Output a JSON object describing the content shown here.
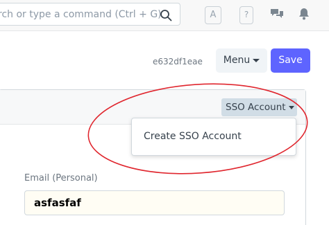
{
  "search": {
    "text": "rch or type a command (Ctrl + G)"
  },
  "navbar": {
    "avatar_letter": "A",
    "help_label": "?"
  },
  "document": {
    "id": "e632df1eae"
  },
  "toolbar": {
    "menu_label": "Menu",
    "save_label": "Save"
  },
  "form": {
    "sso_button_label": "SSO Account",
    "dropdown_items": [
      {
        "label": "Create SSO Account"
      }
    ],
    "email_label": "Email (Personal)",
    "email_value": "asfasfaf"
  },
  "colors": {
    "primary": "#5e64ff",
    "annotation": "#e0262e",
    "input_bg": "#fffdf4"
  },
  "icons": [
    "search-icon",
    "chat-icon",
    "bell-icon",
    "caret-down-icon"
  ]
}
